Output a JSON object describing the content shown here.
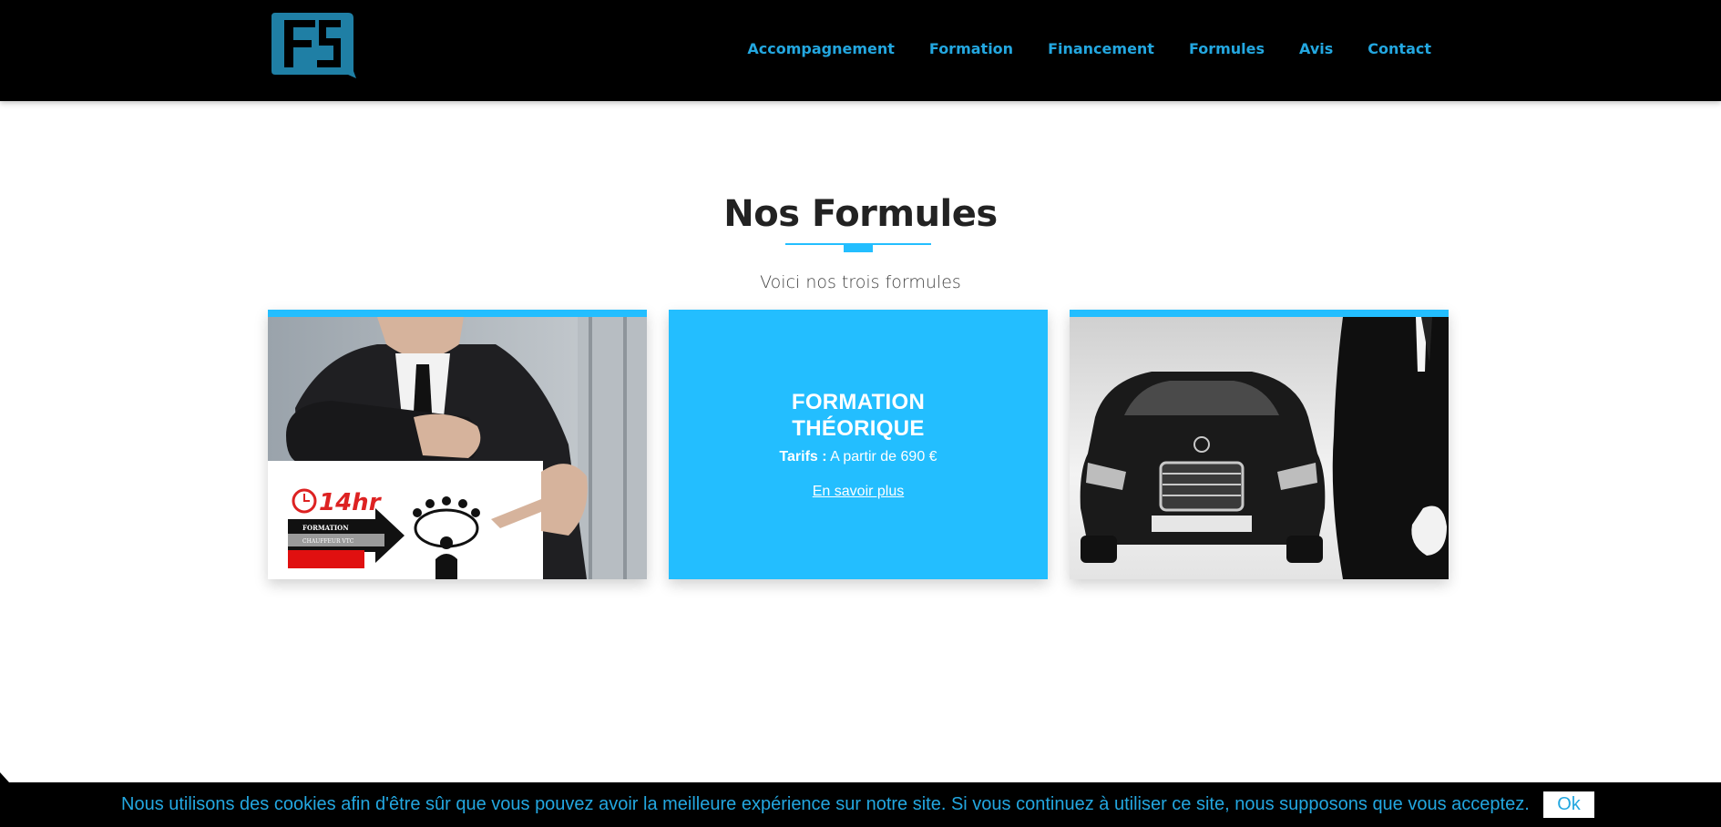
{
  "header": {
    "logo_text": "FS",
    "nav": [
      {
        "label": "Accompagnement"
      },
      {
        "label": "Formation"
      },
      {
        "label": "Financement"
      },
      {
        "label": "Formules"
      },
      {
        "label": "Avis"
      },
      {
        "label": "Contact"
      }
    ]
  },
  "section": {
    "title": "Nos Formules",
    "subtitle": "Voici nos trois formules"
  },
  "cards": [
    {
      "image": "business-man-training-banner",
      "banner_hours": "14hr",
      "banner_line1": "FORMATION",
      "banner_line2": "CHAUFFEUR VTC"
    },
    {
      "title_line1": "FORMATION",
      "title_line2": "THÉORIQUE",
      "price_label": "Tarifs :",
      "price_value": "A partir de 690 €",
      "link_label": "En savoir plus"
    },
    {
      "image": "luxury-car-chauffeur"
    }
  ],
  "cookie": {
    "message": "Nous utilisons des cookies afin d'être sûr que vous pouvez avoir la meilleure expérience sur notre site. Si vous continuez à utiliser ce site, nous supposons que vous acceptez.",
    "ok_label": "Ok"
  },
  "colors": {
    "accent": "#23beff",
    "nav": "#23a7e0",
    "header_bg": "#000000"
  }
}
